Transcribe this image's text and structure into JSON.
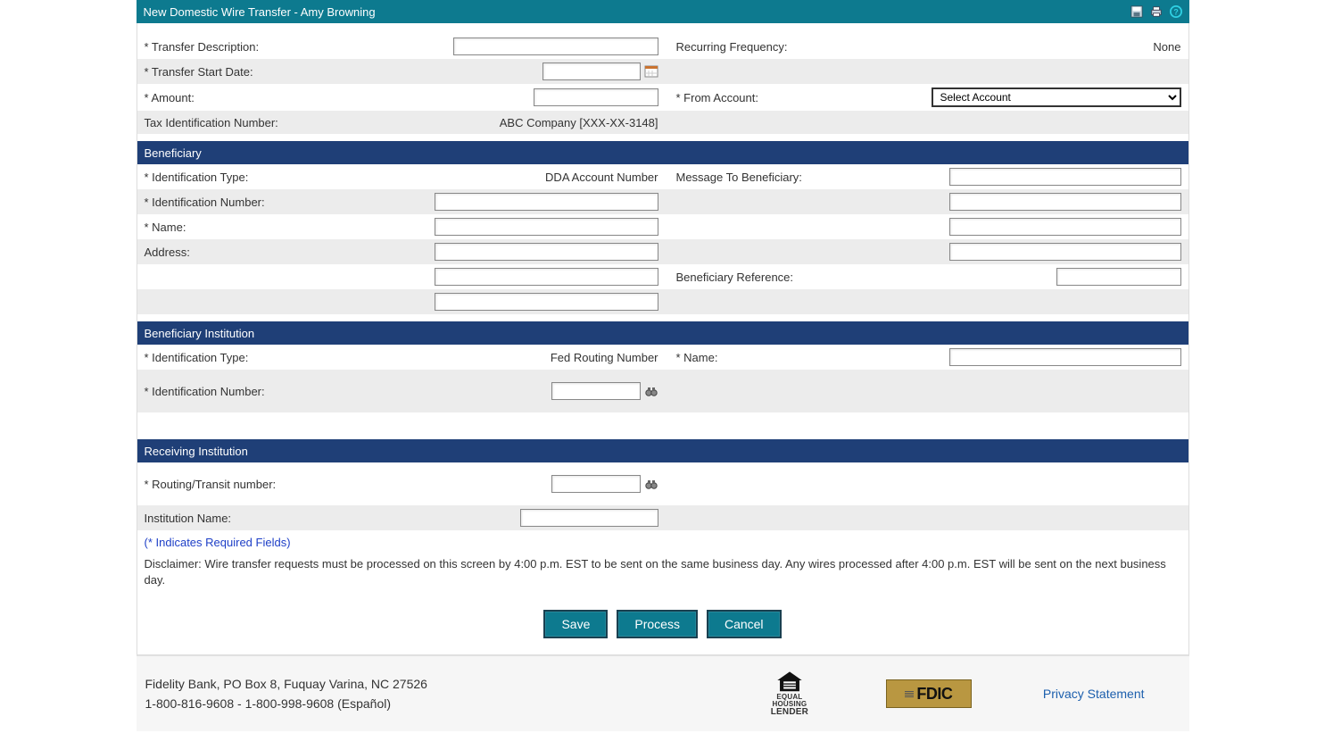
{
  "window": {
    "title": "New Domestic Wire Transfer - Amy Browning"
  },
  "form": {
    "transfer_desc_label": "* Transfer Description:",
    "recurring_freq_label": "Recurring Frequency:",
    "recurring_freq_value": "None",
    "transfer_start_label": "* Transfer Start Date:",
    "amount_label": "* Amount:",
    "from_account_label": "* From Account:",
    "from_account_placeholder": "Select Account",
    "tin_label": "Tax Identification Number:",
    "tin_value": "ABC Company [XXX-XX-3148]"
  },
  "beneficiary": {
    "section_title": "Beneficiary",
    "id_type_label": "* Identification Type:",
    "id_type_value": "DDA Account Number",
    "id_number_label": "* Identification Number:",
    "name_label": "* Name:",
    "address_label": "Address:",
    "msg_label": "Message To Beneficiary:",
    "ref_label": "Beneficiary Reference:"
  },
  "bene_inst": {
    "section_title": "Beneficiary Institution",
    "id_type_label": "* Identification Type:",
    "id_type_value": "Fed Routing Number",
    "id_number_label": "* Identification Number:",
    "name_label": "* Name:"
  },
  "recv_inst": {
    "section_title": "Receiving Institution",
    "routing_label": "* Routing/Transit number:",
    "inst_name_label": "Institution Name:"
  },
  "notes": {
    "required": "(* Indicates Required Fields)",
    "disclaimer": "Disclaimer: Wire transfer requests must be processed on this screen by 4:00 p.m. EST to be sent on the same business day. Any wires processed after 4:00 p.m. EST will be sent on the next business day."
  },
  "buttons": {
    "save": "Save",
    "process": "Process",
    "cancel": "Cancel"
  },
  "footer": {
    "addr": "Fidelity Bank, PO Box 8, Fuquay Varina, NC 27526",
    "phones": "1-800-816-9608 - 1-800-998-9608 (Español)",
    "lender_top": "EQUAL HOUSING",
    "lender_bottom": "LENDER",
    "fdic": "FDIC",
    "privacy": "Privacy Statement"
  }
}
